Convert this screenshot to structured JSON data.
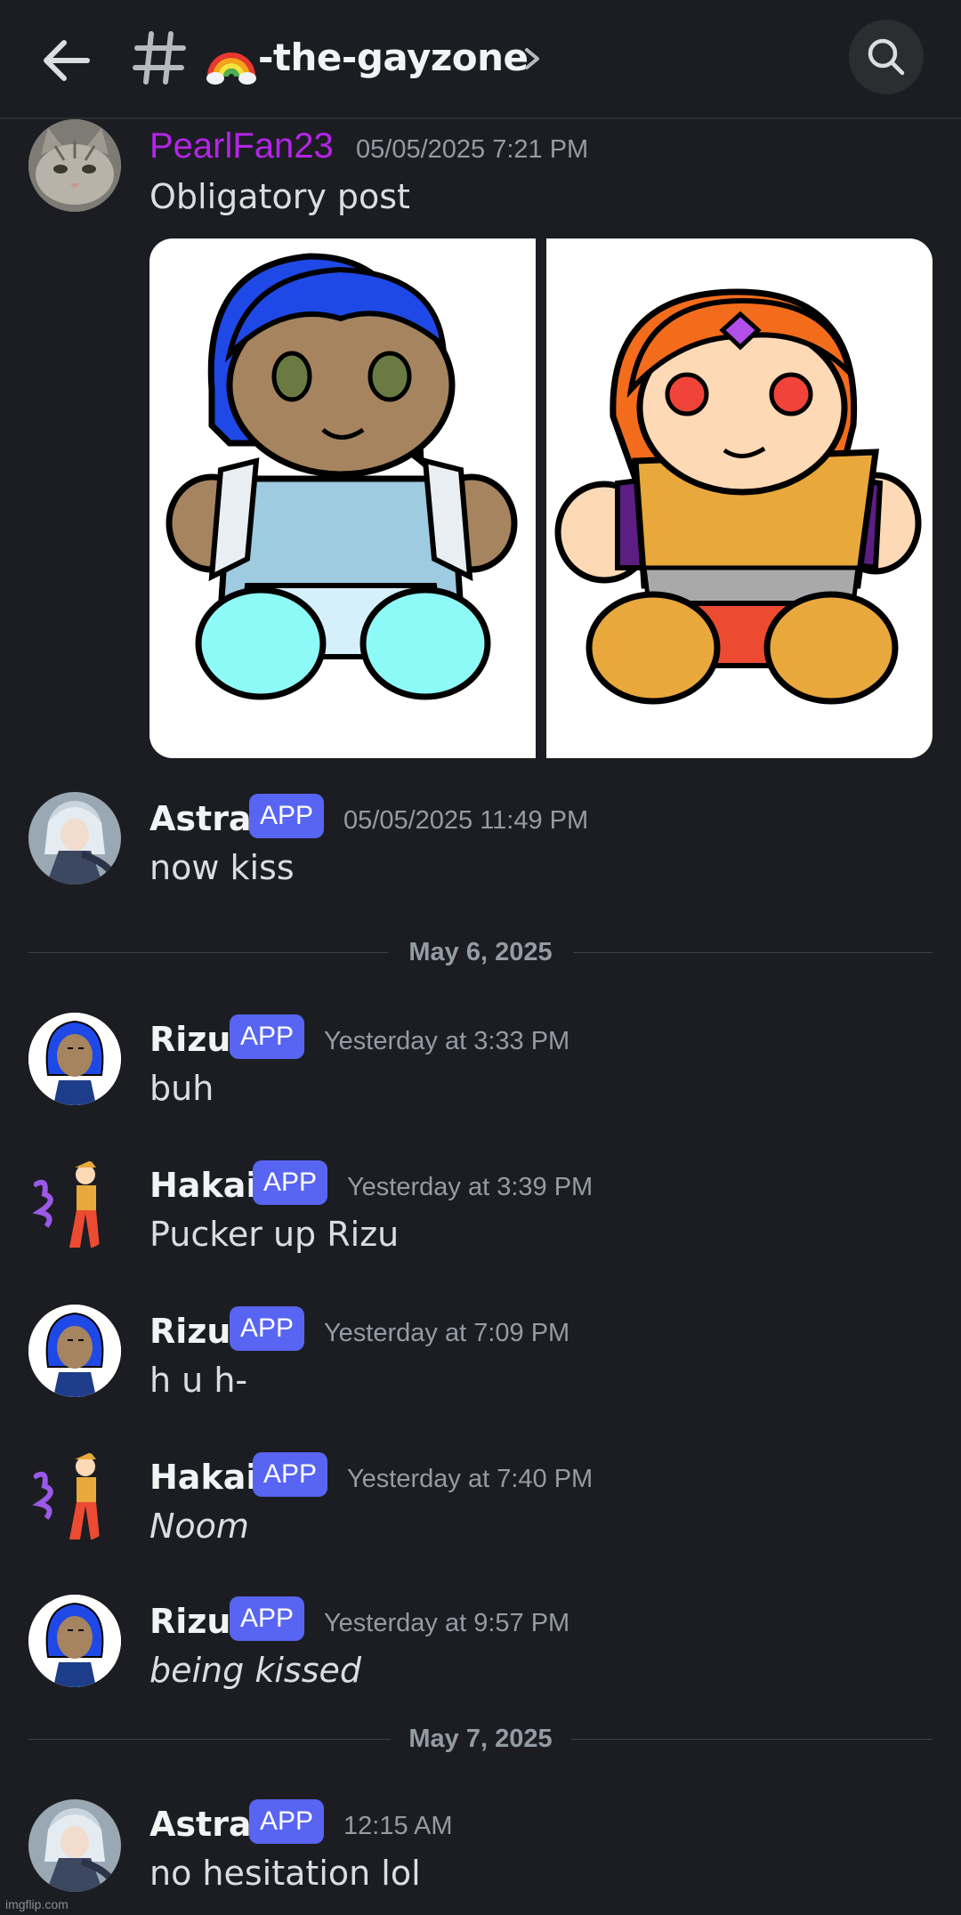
{
  "header": {
    "channel_name": "-the-gayzone",
    "back_icon": "arrow-left-icon",
    "channel_icon": "hash-icon",
    "emoji_icon": "rainbow-emoji-icon",
    "search_icon": "search-icon"
  },
  "colors": {
    "background": "#1c1d22",
    "app_badge": "#5865f2",
    "pearlfan_name": "#b425e8",
    "timestamp": "#949ba4"
  },
  "messages": [
    {
      "author": "PearlFan23",
      "badge": "",
      "time": "05/05/2025 7:21 PM",
      "text": "Obligatory post",
      "attachments": [
        "blue-haired-plush-drawing",
        "orange-haired-plush-drawing"
      ]
    },
    {
      "author": "Astra",
      "badge": "APP",
      "time": "05/05/2025 11:49 PM",
      "text": "now kiss"
    },
    {
      "author": "Rizu",
      "badge": "APP",
      "time": "Yesterday at 3:33 PM",
      "text": "buh"
    },
    {
      "author": "Hakai",
      "badge": "APP",
      "time": "Yesterday at 3:39 PM",
      "text": "Pucker up Rizu"
    },
    {
      "author": "Rizu",
      "badge": "APP",
      "time": "Yesterday at 7:09 PM",
      "text": "h u h-"
    },
    {
      "author": "Hakai",
      "badge": "APP",
      "time": "Yesterday at 7:40 PM",
      "text": "Noom"
    },
    {
      "author": "Rizu",
      "badge": "APP",
      "time": "Yesterday at 9:57 PM",
      "text": "being kissed"
    },
    {
      "author": "Astra",
      "badge": "APP",
      "time": "12:15 AM",
      "text": "no hesitation lol"
    }
  ],
  "dividers": [
    "May 6, 2025",
    "May 7, 2025"
  ],
  "watermark": "imgflip.com"
}
